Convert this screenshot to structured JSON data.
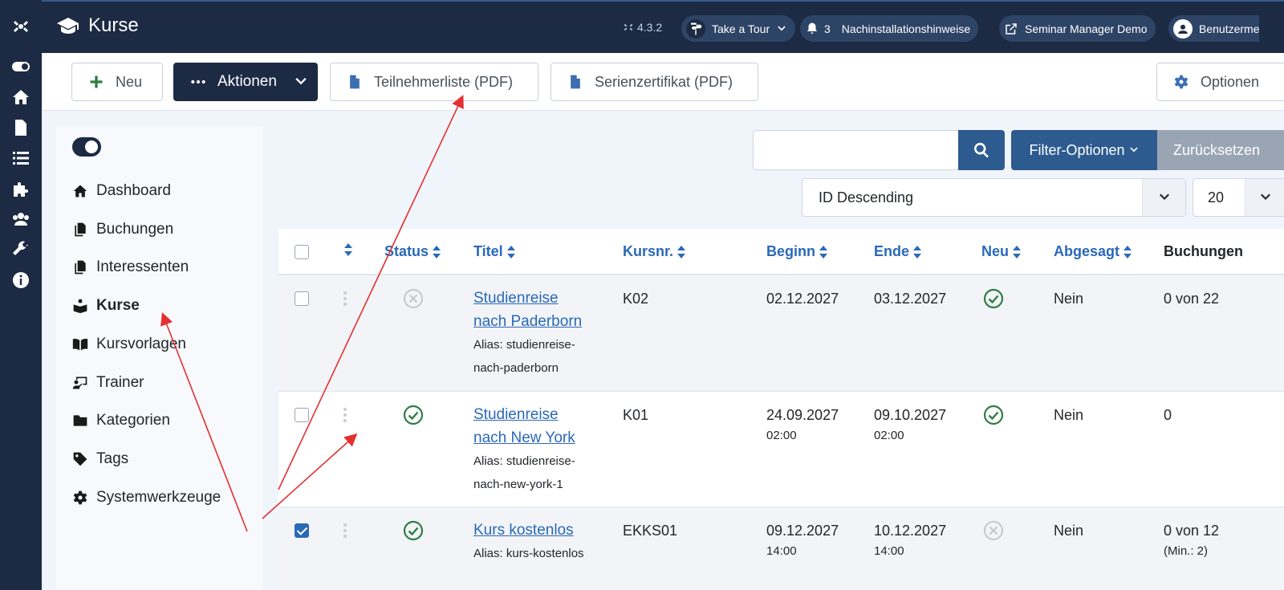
{
  "header": {
    "title": "Kurse",
    "version": "4.3.2",
    "tour_label": "Take a Tour",
    "notifications_count": "3",
    "notifications_label": "Nachinstallationshinweise",
    "site_label": "Seminar Manager Demo",
    "user_label": "Benutzerme"
  },
  "toolbar": {
    "new_label": "Neu",
    "actions_label": "Aktionen",
    "participant_list_label": "Teilnehmerliste (PDF)",
    "certificate_label": "Serienzertifikat (PDF)",
    "options_label": "Optionen"
  },
  "sidebar": {
    "items": [
      {
        "label": "Dashboard",
        "icon": "home-icon"
      },
      {
        "label": "Buchungen",
        "icon": "copy-icon"
      },
      {
        "label": "Interessenten",
        "icon": "copy-icon"
      },
      {
        "label": "Kurse",
        "icon": "reader-icon",
        "active": true
      },
      {
        "label": "Kursvorlagen",
        "icon": "book-icon"
      },
      {
        "label": "Trainer",
        "icon": "trainer-icon"
      },
      {
        "label": "Kategorien",
        "icon": "folder-icon"
      },
      {
        "label": "Tags",
        "icon": "tag-icon"
      },
      {
        "label": "Systemwerkzeuge",
        "icon": "gear-icon"
      }
    ]
  },
  "filters": {
    "search_value": "",
    "filter_options_label": "Filter-Optionen",
    "reset_label": "Zurücksetzen",
    "sort_value": "ID Descending",
    "limit_value": "20"
  },
  "table": {
    "headers": {
      "status": "Status",
      "title": "Titel",
      "course_no": "Kursnr.",
      "begin": "Beginn",
      "end": "Ende",
      "new": "Neu",
      "cancelled": "Abgesagt",
      "bookings": "Buchungen"
    },
    "rows": [
      {
        "checked": false,
        "status": "unpublished",
        "title_line1": "Studienreise",
        "title_line2": "nach Paderborn",
        "alias_line1": "Alias: studienreise-",
        "alias_line2": "nach-paderborn",
        "course_no": "K02",
        "begin_date": "02.12.2027",
        "begin_time": "",
        "end_date": "03.12.2027",
        "end_time": "",
        "new": "yes",
        "cancelled": "Nein",
        "bookings": "0 von 22",
        "bookings_min": ""
      },
      {
        "checked": false,
        "status": "published",
        "title_line1": "Studienreise",
        "title_line2": "nach New York",
        "alias_line1": "Alias: studienreise-",
        "alias_line2": "nach-new-york-1",
        "course_no": "K01",
        "begin_date": "24.09.2027",
        "begin_time": "02:00",
        "end_date": "09.10.2027",
        "end_time": "02:00",
        "new": "yes",
        "cancelled": "Nein",
        "bookings": "0",
        "bookings_min": ""
      },
      {
        "checked": true,
        "status": "published",
        "title_line1": "Kurs kostenlos",
        "title_line2": "",
        "alias_line1": "Alias: kurs-kostenlos",
        "alias_line2": "",
        "course_no": "EKKS01",
        "begin_date": "09.12.2027",
        "begin_time": "14:00",
        "end_date": "10.12.2027",
        "end_time": "14:00",
        "new": "no",
        "cancelled": "Nein",
        "bookings": "0 von 12",
        "bookings_min": "(Min.: 2)"
      }
    ]
  },
  "colors": {
    "header_bg": "#1c2a44",
    "accent": "#2a69b8",
    "success": "#2f7d45",
    "annotation": "#e53030"
  }
}
